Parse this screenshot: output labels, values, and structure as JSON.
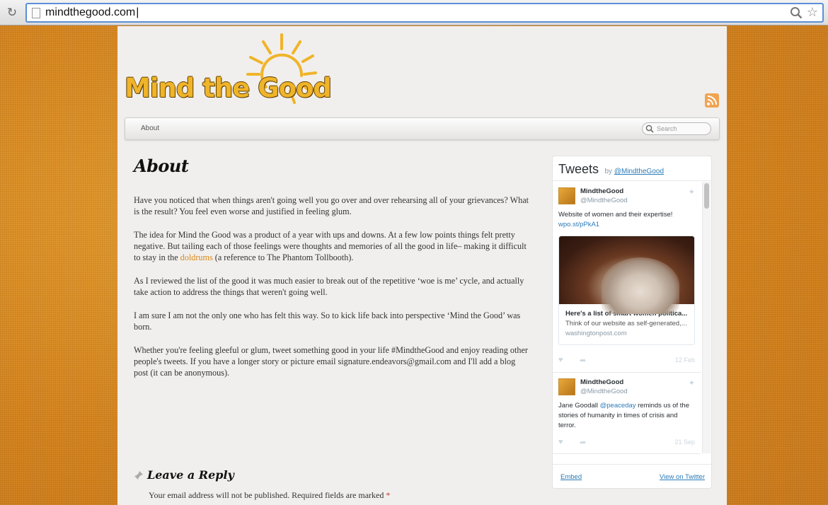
{
  "browser": {
    "url": "mindthegood.com"
  },
  "site": {
    "logo_text": "Mind the Good",
    "nav": {
      "about": "About"
    },
    "search": {
      "placeholder": "Search"
    }
  },
  "page": {
    "title": "About",
    "paragraphs": {
      "p1": "Have you noticed that when things aren't going well you go over and over rehearsing all of your grievances? What is the result? You feel even worse and justified in feeling glum.",
      "p2_before": "The idea for Mind the Good was a product of a year with ups and downs. At a few low points things felt pretty negative. But tailing each of those feelings were thoughts and memories of all the good in life– making it difficult to stay in the ",
      "p2_link": "doldrums",
      "p2_after": " (a reference to The Phantom Tollbooth).",
      "p3": "As I reviewed the list of the good it was much easier to break out of the repetitive ‘woe is me’ cycle, and actually take action to address the things that weren't going well.",
      "p4": "I am sure I am not the only one who has felt this way. So to kick life back into perspective ‘Mind the Good’ was born.",
      "p5": "Whether you're feeling gleeful or glum, tweet something good in your life #MindtheGood and enjoy reading other people's tweets. If you have a longer story or picture email signature.endeavors@gmail.com and I'll add a blog post (it can be anonymous)."
    },
    "reply": {
      "title": "Leave a Reply",
      "note": "Your email address will not be published. Required fields are marked ",
      "required_mark": "*"
    }
  },
  "twitter": {
    "title": "Tweets",
    "by": "by",
    "handle": "@MindtheGood",
    "tweets": [
      {
        "name": "MindtheGood",
        "handle": "@MindtheGood",
        "text": "Website of women and their expertise!",
        "link": "wpo.st/pPkA1",
        "card": {
          "title": "Here's a list of smart women politica...",
          "desc": "Think of our website as self-generated,...",
          "domain": "washingtonpost.com"
        },
        "date": "12 Feb"
      },
      {
        "name": "MindtheGood",
        "handle": "@MindtheGood",
        "text_before": "Jane Goodall ",
        "mention": "@peaceday",
        "text_after": " reminds us of the stories of humanity in times of crisis and terror.",
        "date": "21 Sep"
      }
    ],
    "footer": {
      "embed": "Embed",
      "view": "View on Twitter"
    }
  }
}
